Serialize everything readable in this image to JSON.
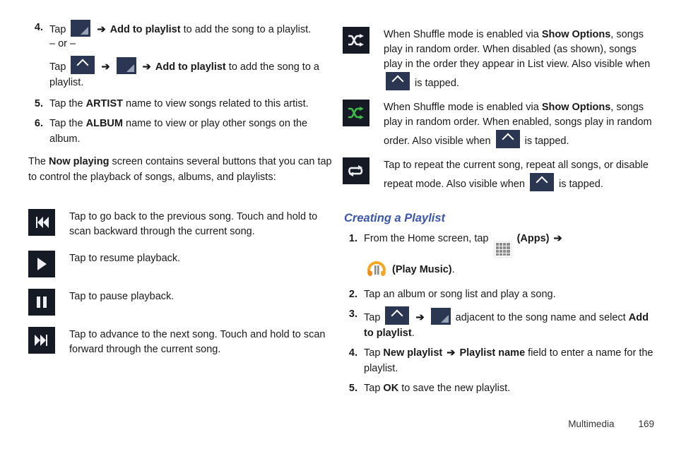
{
  "document": {
    "footer": {
      "section": "Multimedia",
      "page": "169"
    }
  },
  "left_column": {
    "steps": [
      {
        "num": "4.",
        "line1_pre": "Tap",
        "line1_mid": "Add to playlist",
        "line1_post": "to add the song to a playlist.",
        "or": "– or –",
        "line2_pre": "Tap",
        "line2_mid": "Add to playlist",
        "line2_post": "to add the song to",
        "line3": "a playlist."
      },
      {
        "num": "5.",
        "pre": "Tap the",
        "bold": "ARTIST",
        "post": "name to view songs related to this artist."
      },
      {
        "num": "6.",
        "pre": "Tap the",
        "bold": "ALBUM",
        "post": "name to view or play other songs on the album."
      }
    ],
    "paragraph": {
      "pre": "The",
      "bold": "Now playing",
      "post": "screen contains several buttons that you can tap to control the playback of songs, albums, and playlists:"
    },
    "controls": [
      {
        "icon": "previous-track-icon",
        "text": "Tap to go back to the previous song. Touch and hold to scan backward through the current song."
      },
      {
        "icon": "play-icon",
        "text": "Tap to resume playback."
      },
      {
        "icon": "pause-icon",
        "text": "Tap to pause playback."
      },
      {
        "icon": "next-track-icon",
        "text": "Tap to advance to the next song. Touch and hold to scan forward through the current song."
      }
    ]
  },
  "right_column": {
    "modes": [
      {
        "icon": "shuffle-off-icon",
        "icon_color": "#ffffff",
        "t1": "When Shuffle mode is enabled via",
        "b1": "Show Options",
        "t2": ", songs play in random order. When disabled (as shown), songs play in the order they appear in List view. Also visible when",
        "t3": "is tapped."
      },
      {
        "icon": "shuffle-on-icon",
        "icon_color": "#3ebc4a",
        "t1": "When Shuffle mode is enabled via",
        "b1": "Show Options",
        "t2": ", songs play in random order. When enabled, songs play in random order. Also visible when",
        "t3": "is tapped."
      },
      {
        "icon": "repeat-icon",
        "icon_color": "#ffffff",
        "t1": "Tap to repeat the current song, repeat all songs, or disable repeat mode. Also visible when",
        "b1": "",
        "t2": "",
        "t3": "is tapped."
      }
    ],
    "section_title": "Creating a Playlist",
    "steps": [
      {
        "num": "1.",
        "pre": "From the Home screen, tap",
        "apps_label": "(Apps)",
        "music_label": "(Play Music)",
        "post": "."
      },
      {
        "num": "2.",
        "text": "Tap an album or song list and play a song."
      },
      {
        "num": "3.",
        "pre": "Tap",
        "mid": "adjacent to the song name and select",
        "bold": "Add to playlist",
        "post": "."
      },
      {
        "num": "4.",
        "pre": "Tap",
        "b1": "New playlist",
        "b2": "Playlist name",
        "post": "field to enter a name for the playlist."
      },
      {
        "num": "5.",
        "pre": "Tap",
        "bold": "OK",
        "post": "to save the new playlist."
      }
    ]
  },
  "symbols": {
    "arrow": "➔"
  }
}
